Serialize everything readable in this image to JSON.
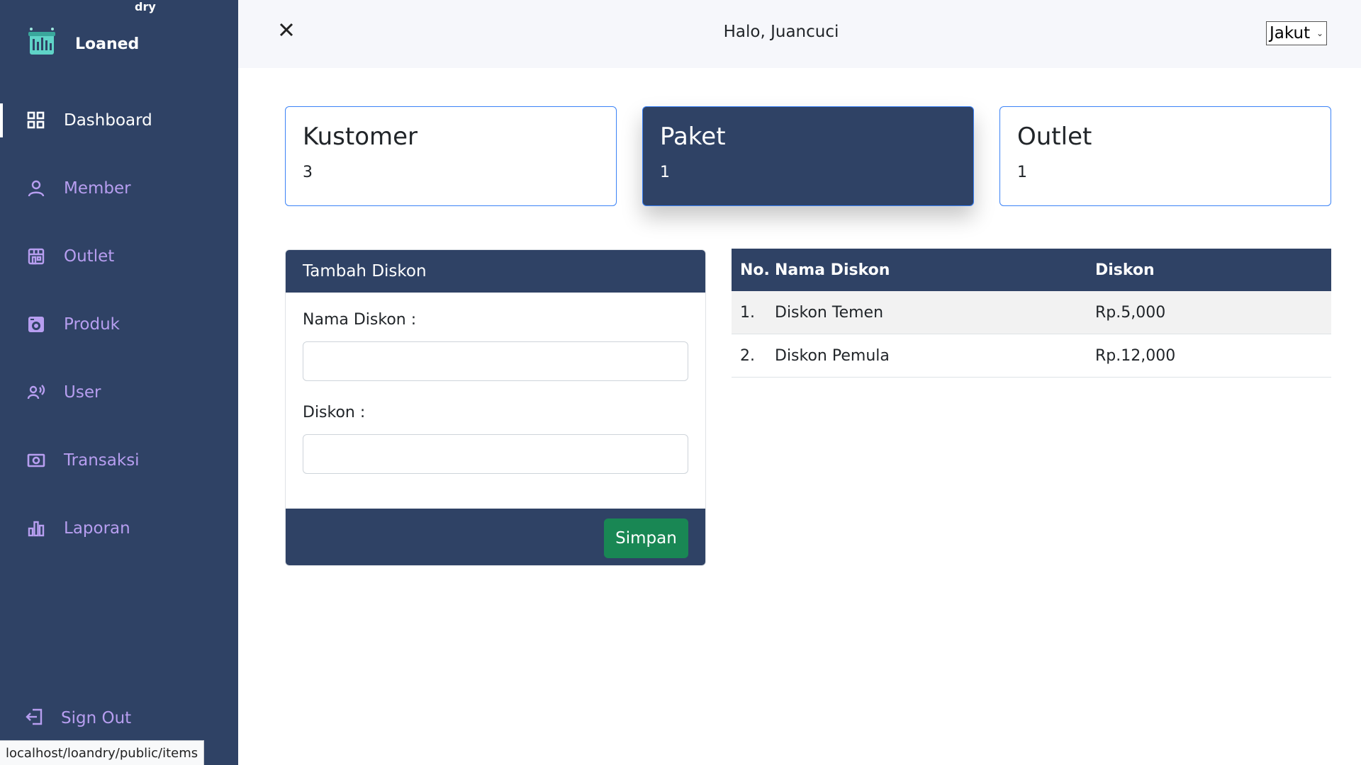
{
  "brand": {
    "name": "Loaned",
    "superscript": "dry"
  },
  "sidebar": {
    "items": [
      {
        "label": "Dashboard",
        "icon": "grid-icon",
        "active": true
      },
      {
        "label": "Member",
        "icon": "person-icon",
        "active": false
      },
      {
        "label": "Outlet",
        "icon": "store-icon",
        "active": false
      },
      {
        "label": "Produk",
        "icon": "washing-machine-icon",
        "active": false
      },
      {
        "label": "User",
        "icon": "user-voice-icon",
        "active": false
      },
      {
        "label": "Transaksi",
        "icon": "cash-icon",
        "active": false
      },
      {
        "label": "Laporan",
        "icon": "bar-chart-icon",
        "active": false
      }
    ],
    "signout": {
      "label": "Sign Out",
      "icon": "sign-out-icon"
    }
  },
  "status_bar": {
    "url": "localhost/loandry/public/items"
  },
  "topbar": {
    "greeting": "Halo, Juancuci",
    "outlet_select": {
      "value": "Jakut"
    }
  },
  "stats": [
    {
      "title": "Kustomer",
      "value": "3"
    },
    {
      "title": "Paket",
      "value": "1"
    },
    {
      "title": "Outlet",
      "value": "1"
    }
  ],
  "form": {
    "title": "Tambah Diskon",
    "name_label": "Nama Diskon :",
    "name_value": "",
    "discount_label": "Diskon :",
    "discount_value": "",
    "submit_label": "Simpan"
  },
  "table": {
    "columns": [
      "No.",
      "Nama Diskon",
      "Diskon"
    ],
    "rows": [
      {
        "no": "1.",
        "name": "Diskon Temen",
        "discount": "Rp.5,000"
      },
      {
        "no": "2.",
        "name": "Diskon Pemula",
        "discount": "Rp.12,000"
      }
    ]
  },
  "colors": {
    "sidebar_bg": "#2f4265",
    "nav_text": "#b79ef0",
    "accent_border": "#3b82f6",
    "success": "#198754"
  }
}
